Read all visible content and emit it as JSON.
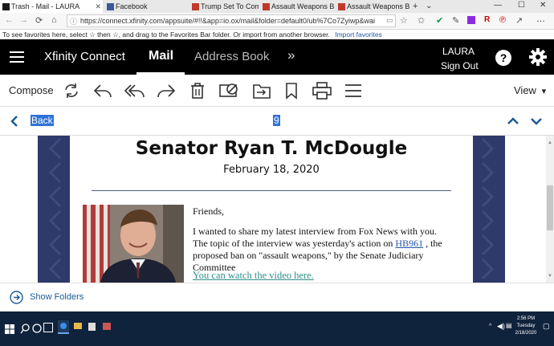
{
  "browser": {
    "tabs": [
      {
        "label": "Trash - Mail - LAURA",
        "active": true,
        "fav_color": "#1a1a1a"
      },
      {
        "label": "Facebook",
        "active": false,
        "fav_color": "#3b5998"
      },
      {
        "label": "Trump Set To Comm",
        "active": false,
        "fav_color": "#c0392b"
      },
      {
        "label": "Assault Weapons Ba",
        "active": false,
        "fav_color": "#c0392b"
      },
      {
        "label": "Assault Weapons Ba",
        "active": false,
        "fav_color": "#c0392b"
      }
    ],
    "url": "https://connect.xfinity.com/appsuite/#!!&app=io.ox/mail&folder=default0/ub%7Co7Zyiwp&wai",
    "favorites_hint": "To see favorites here, select  ☆  then ☆, and drag to the Favorites Bar folder. Or import from another browser.",
    "import_link": "Import favorites"
  },
  "app": {
    "brand": "Xfinity Connect",
    "nav": [
      {
        "label": "Mail",
        "active": true
      },
      {
        "label": "Address Book",
        "active": false
      }
    ],
    "more_glyph": "»",
    "user_name": "LAURA",
    "sign_out": "Sign Out"
  },
  "toolbar": {
    "compose": "Compose",
    "view": "View",
    "view_caret": "▾"
  },
  "navrow": {
    "back": "Back",
    "counter": "9"
  },
  "email": {
    "heading": "Senator Ryan T. McDougle",
    "date": "February 18, 2020",
    "greeting": "Friends,",
    "para_before_link": "I wanted to share my latest interview from Fox News with you. The topic of the interview was yesterday's action on ",
    "bill_link": "HB961",
    "para_after_link": " , the proposed ban on \"assault weapons,\" by the Senate Judiciary Committee",
    "video_link": "You can watch the video here."
  },
  "footer": {
    "show_folders": "Show Folders"
  },
  "taskbar": {
    "time": "2:56 PM",
    "day": "Tuesday",
    "date": "2/18/2020"
  },
  "colors": {
    "app_bar": "#000000",
    "accent_blue": "#1a5a96",
    "link_blue": "#2255aa",
    "link_teal": "#2e8f8a",
    "side_band": "#2e3a6a",
    "taskbar": "#10233c"
  }
}
